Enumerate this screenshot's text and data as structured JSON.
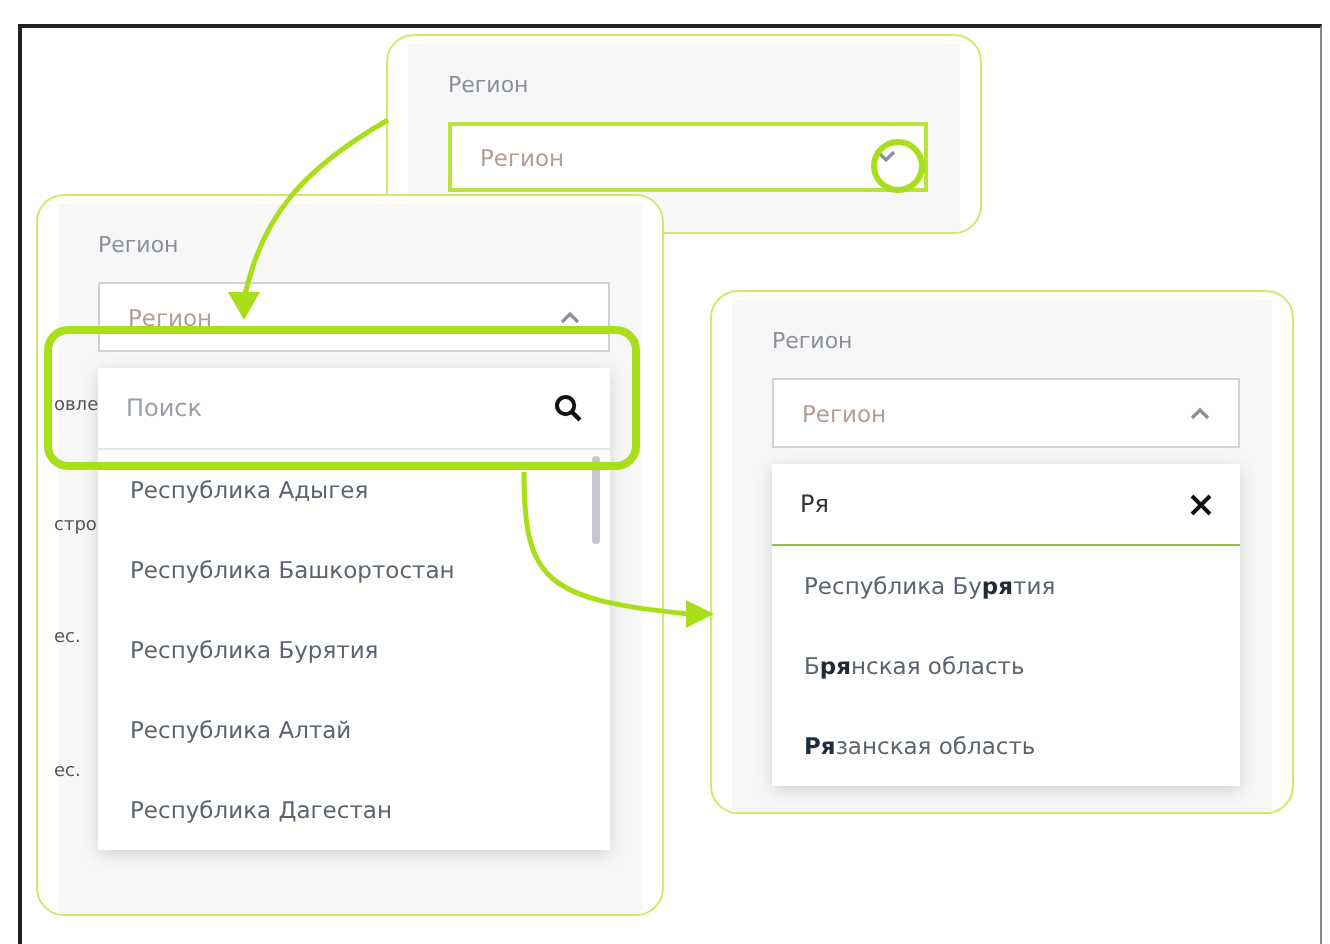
{
  "top_panel": {
    "label": "Регион",
    "select": {
      "placeholder": "Регион",
      "expanded": false,
      "highlighted": true
    }
  },
  "left_panel": {
    "label": "Регион",
    "select": {
      "placeholder": "Регион",
      "expanded": true,
      "highlighted": false
    },
    "background_texts": [
      "овле",
      "стро",
      "ес.",
      "ес."
    ],
    "search": {
      "placeholder": "Поиск"
    },
    "options": [
      "Республика Адыгея",
      "Республика Башкортостан",
      "Республика Бурятия",
      "Республика Алтай",
      "Республика Дагестан"
    ]
  },
  "right_panel": {
    "label": "Регион",
    "select": {
      "placeholder": "Регион",
      "expanded": true,
      "highlighted": false
    },
    "search": {
      "value": "Ря"
    },
    "options": [
      "Республика Бу**ря**тия",
      "Б**ря**нская область",
      "**Ря**занская область"
    ]
  }
}
